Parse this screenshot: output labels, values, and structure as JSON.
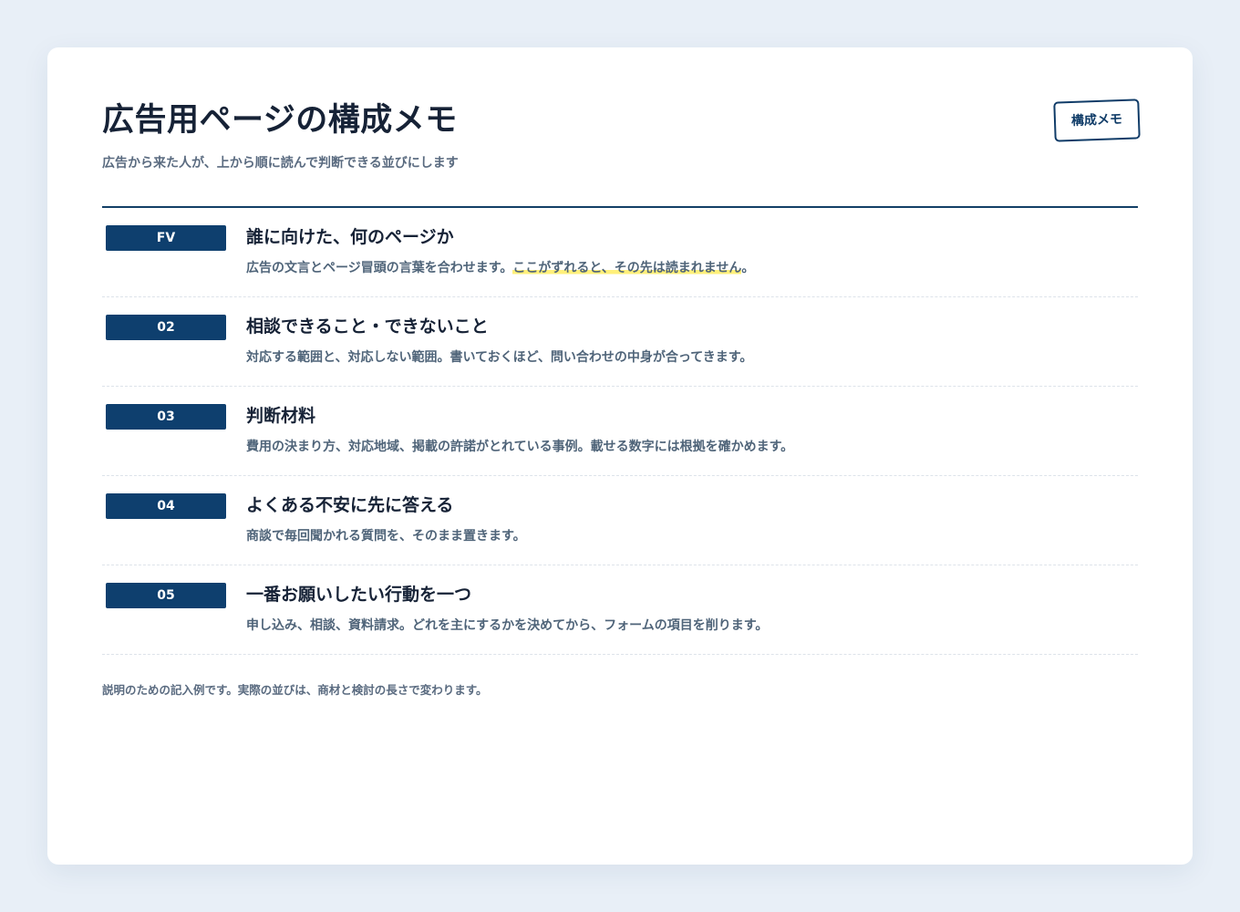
{
  "header": {
    "title": "広告用ページの構成メモ",
    "subtitle": "広告から来た人が、上から順に読んで判断できる並びにします",
    "stamp_label": "構成メモ"
  },
  "sections": [
    {
      "badge": "FV",
      "heading": "誰に向けた、何のページか",
      "desc_before": "広告の文言とページ冒頭の言葉を合わせます。",
      "desc_highlight": "ここがずれると、その先は読まれません",
      "desc_after": "。"
    },
    {
      "badge": "02",
      "heading": "相談できること・できないこと",
      "desc_before": "対応する範囲と、対応しない範囲。書いておくほど、問い合わせの中身が合ってきます。",
      "desc_highlight": "",
      "desc_after": ""
    },
    {
      "badge": "03",
      "heading": "判断材料",
      "desc_before": "費用の決まり方、対応地域、掲載の許諾がとれている事例。載せる数字には根拠を確かめます。",
      "desc_highlight": "",
      "desc_after": ""
    },
    {
      "badge": "04",
      "heading": "よくある不安に先に答える",
      "desc_before": "商談で毎回聞かれる質問を、そのまま置きます。",
      "desc_highlight": "",
      "desc_after": ""
    },
    {
      "badge": "05",
      "heading": "一番お願いしたい行動を一つ",
      "desc_before": "申し込み、相談、資料請求。どれを主にするかを決めてから、フォームの項目を削ります。",
      "desc_highlight": "",
      "desc_after": ""
    }
  ],
  "footnote": "説明のための記入例です。実際の並びは、商材と検討の長さで変わります。",
  "colors": {
    "background": "#e8eff7",
    "accent": "#0e3f6e",
    "highlight": "#fff07a"
  }
}
